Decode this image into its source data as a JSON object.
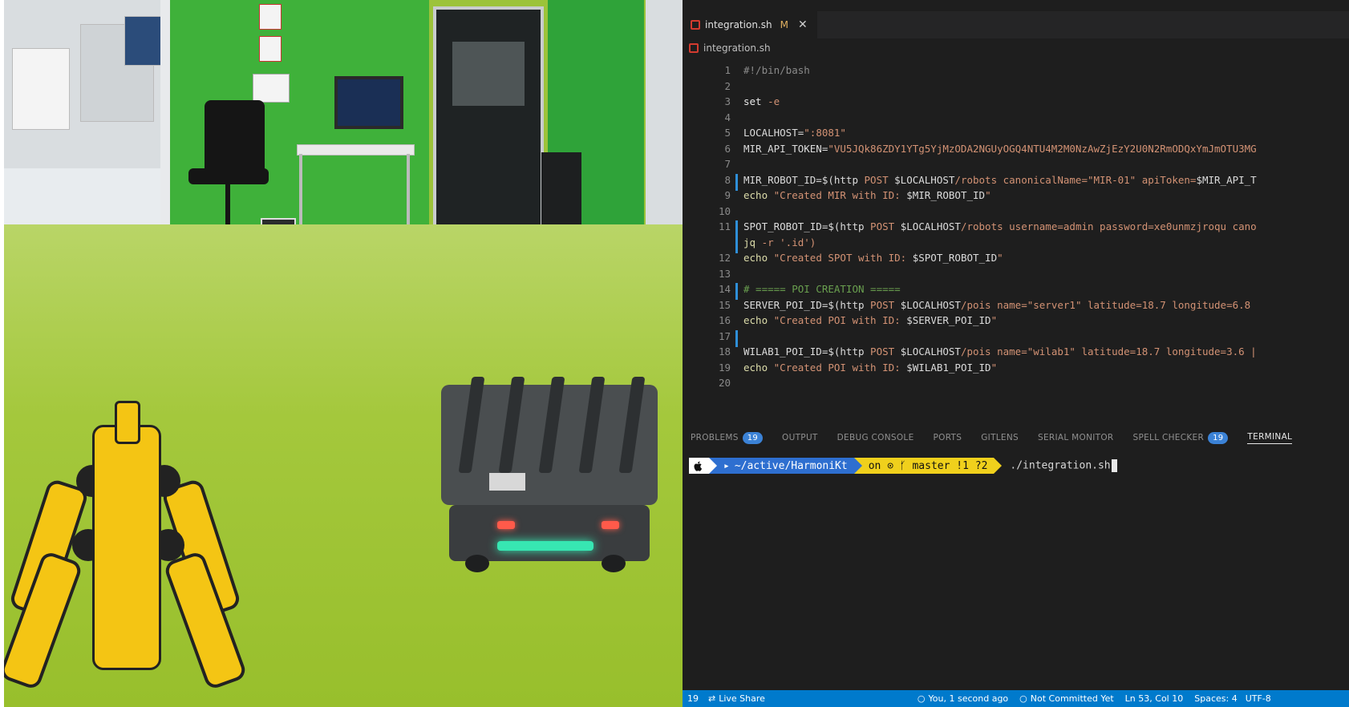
{
  "editor": {
    "tab": {
      "label": "integration.sh",
      "modified": "M",
      "close": "✕"
    },
    "breadcrumb": "integration.sh",
    "lines": [
      {
        "n": "1",
        "parts": [
          {
            "c": "c-cmt",
            "t": "#!/bin/bash"
          }
        ]
      },
      {
        "n": "2",
        "parts": []
      },
      {
        "n": "3",
        "parts": [
          {
            "c": "c-kw",
            "t": "set "
          },
          {
            "c": "c-str",
            "t": "-e"
          }
        ]
      },
      {
        "n": "4",
        "parts": []
      },
      {
        "n": "5",
        "parts": [
          {
            "c": "c-var",
            "t": "LOCALHOST="
          },
          {
            "c": "c-str",
            "t": "\":8081\""
          }
        ]
      },
      {
        "n": "6",
        "parts": [
          {
            "c": "c-var",
            "t": "MIR_API_TOKEN="
          },
          {
            "c": "c-str",
            "t": "\"VU5JQk86ZDY1YTg5YjMzODA2NGUyOGQ4NTU4M2M0NzAwZjEzY2U0N2RmODQxYmJmOTU3MG"
          }
        ]
      },
      {
        "n": "7",
        "parts": []
      },
      {
        "n": "8",
        "gutter": true,
        "parts": [
          {
            "c": "c-var",
            "t": "MIR_ROBOT_ID=$(http "
          },
          {
            "c": "c-str",
            "t": "POST "
          },
          {
            "c": "c-var",
            "t": "$LOCALHOST"
          },
          {
            "c": "c-str",
            "t": "/robots canonicalName=\"MIR-01\" apiToken="
          },
          {
            "c": "c-var",
            "t": "$MIR_API_T"
          }
        ]
      },
      {
        "n": "9",
        "parts": [
          {
            "c": "c-cmd",
            "t": "echo "
          },
          {
            "c": "c-str",
            "t": "\"Created MIR with ID: "
          },
          {
            "c": "c-var",
            "t": "$MIR_ROBOT_ID"
          },
          {
            "c": "c-str",
            "t": "\""
          }
        ]
      },
      {
        "n": "10",
        "parts": []
      },
      {
        "n": "11",
        "gutter": true,
        "parts": [
          {
            "c": "c-var",
            "t": "SPOT_ROBOT_ID=$(http "
          },
          {
            "c": "c-str",
            "t": "POST "
          },
          {
            "c": "c-var",
            "t": "$LOCALHOST"
          },
          {
            "c": "c-str",
            "t": "/robots username=admin password=xe0unmzjroqu cano"
          }
        ]
      },
      {
        "n": "",
        "gutter": true,
        "parts": [
          {
            "c": "c-cmd",
            "t": "jq "
          },
          {
            "c": "c-str",
            "t": "-r '.id')"
          }
        ]
      },
      {
        "n": "12",
        "parts": [
          {
            "c": "c-cmd",
            "t": "echo "
          },
          {
            "c": "c-str",
            "t": "\"Created SPOT with ID: "
          },
          {
            "c": "c-var",
            "t": "$SPOT_ROBOT_ID"
          },
          {
            "c": "c-str",
            "t": "\""
          }
        ]
      },
      {
        "n": "13",
        "parts": []
      },
      {
        "n": "14",
        "gutter": true,
        "parts": [
          {
            "c": "c-sec",
            "t": "# ===== POI CREATION ====="
          }
        ]
      },
      {
        "n": "15",
        "parts": [
          {
            "c": "c-var",
            "t": "SERVER_POI_ID=$(http "
          },
          {
            "c": "c-str",
            "t": "POST "
          },
          {
            "c": "c-var",
            "t": "$LOCALHOST"
          },
          {
            "c": "c-str",
            "t": "/pois name=\"server1\" latitude=18.7 longitude=6.8"
          }
        ]
      },
      {
        "n": "16",
        "parts": [
          {
            "c": "c-cmd",
            "t": "echo "
          },
          {
            "c": "c-str",
            "t": "\"Created POI with ID: "
          },
          {
            "c": "c-var",
            "t": "$SERVER_POI_ID"
          },
          {
            "c": "c-str",
            "t": "\""
          }
        ]
      },
      {
        "n": "17",
        "gutter": true,
        "parts": []
      },
      {
        "n": "18",
        "parts": [
          {
            "c": "c-var",
            "t": "WILAB1_POI_ID=$(http "
          },
          {
            "c": "c-str",
            "t": "POST "
          },
          {
            "c": "c-var",
            "t": "$LOCALHOST"
          },
          {
            "c": "c-str",
            "t": "/pois name=\"wilab1\" latitude=18.7 longitude=3.6 |"
          }
        ]
      },
      {
        "n": "19",
        "parts": [
          {
            "c": "c-cmd",
            "t": "echo "
          },
          {
            "c": "c-str",
            "t": "\"Created POI with ID: "
          },
          {
            "c": "c-var",
            "t": "$WILAB1_POI_ID"
          },
          {
            "c": "c-str",
            "t": "\""
          }
        ]
      },
      {
        "n": "20",
        "parts": []
      }
    ]
  },
  "panel": {
    "tabs": [
      {
        "label": "PROBLEMS",
        "badge": "19",
        "active": false
      },
      {
        "label": "OUTPUT",
        "badge": "",
        "active": false
      },
      {
        "label": "DEBUG CONSOLE",
        "badge": "",
        "active": false
      },
      {
        "label": "PORTS",
        "badge": "",
        "active": false
      },
      {
        "label": "GITLENS",
        "badge": "",
        "active": false
      },
      {
        "label": "SERIAL MONITOR",
        "badge": "",
        "active": false
      },
      {
        "label": "SPELL CHECKER",
        "badge": "19",
        "active": false
      },
      {
        "label": "TERMINAL",
        "badge": "",
        "active": true
      }
    ]
  },
  "terminal": {
    "os_icon": "",
    "path": "~/active/HarmoniKt",
    "git": "on ⊙ ᚶ master !1 ?2",
    "command": "./integration.sh"
  },
  "statusbar": {
    "items": [
      {
        "icon": "",
        "label": "19"
      },
      {
        "icon": "⇄",
        "label": "Live Share"
      },
      {
        "icon": "○",
        "label": "You, 1 second ago"
      },
      {
        "icon": "○",
        "label": "Not Committed Yet"
      },
      {
        "icon": "",
        "label": "Ln 53, Col 10"
      },
      {
        "icon": "",
        "label": "Spaces: 4"
      },
      {
        "icon": "",
        "label": "UTF-8"
      }
    ]
  },
  "colors": {
    "accent": "#007acc",
    "terminal_path_bg": "#2e6fd0",
    "terminal_git_bg": "#f0d01c",
    "badge": "#3b82d6"
  }
}
